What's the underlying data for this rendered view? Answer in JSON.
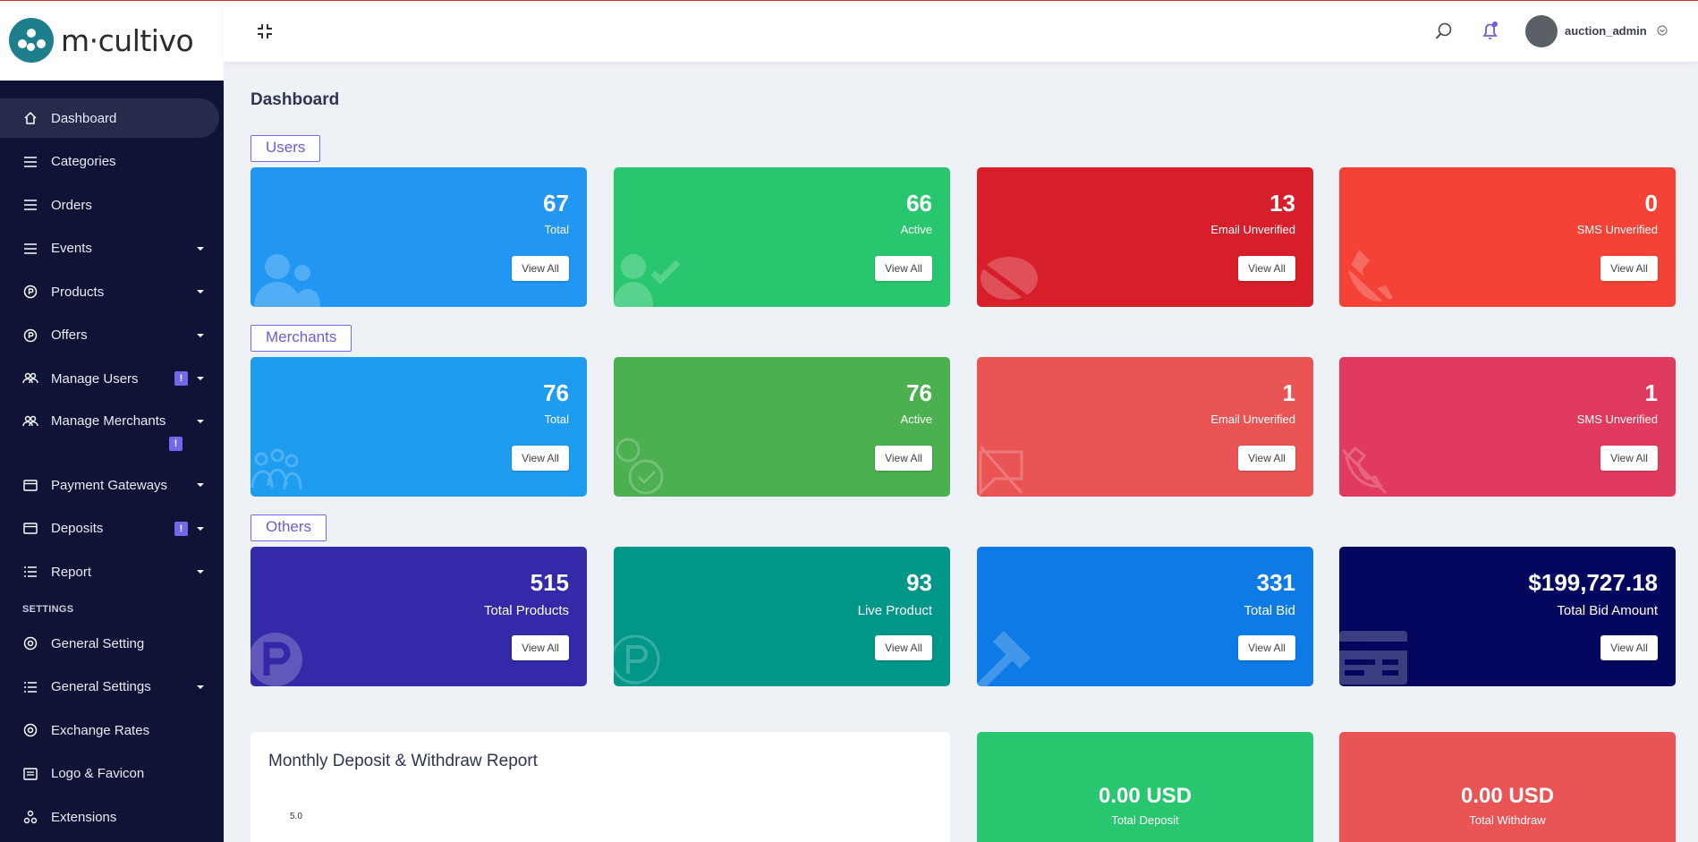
{
  "brand": {
    "name": "m·cultivo"
  },
  "header": {
    "username": "auction_admin"
  },
  "sidebar": {
    "items": [
      {
        "label": "Dashboard"
      },
      {
        "label": "Categories"
      },
      {
        "label": "Orders"
      },
      {
        "label": "Events"
      },
      {
        "label": "Products"
      },
      {
        "label": "Offers"
      },
      {
        "label": "Manage Users",
        "badge": "!"
      },
      {
        "label": "Manage Merchants",
        "badge": "!"
      },
      {
        "label": "Payment Gateways"
      },
      {
        "label": "Deposits",
        "badge": "!"
      },
      {
        "label": "Report"
      }
    ],
    "settings_heading": "SETTINGS",
    "settings_items": [
      {
        "label": "General Setting"
      },
      {
        "label": "General Settings"
      },
      {
        "label": "Exchange Rates"
      },
      {
        "label": "Logo & Favicon"
      },
      {
        "label": "Extensions"
      }
    ]
  },
  "page": {
    "title": "Dashboard"
  },
  "sections": {
    "users": {
      "label": "Users",
      "cards": [
        {
          "value": "67",
          "label": "Total",
          "button": "View All",
          "color": "#2196f3"
        },
        {
          "value": "66",
          "label": "Active",
          "button": "View All",
          "color": "#28c76f"
        },
        {
          "value": "13",
          "label": "Email Unverified",
          "button": "View All",
          "color": "#d71f2b"
        },
        {
          "value": "0",
          "label": "SMS Unverified",
          "button": "View All",
          "color": "#f44336"
        }
      ]
    },
    "merchants": {
      "label": "Merchants",
      "cards": [
        {
          "value": "76",
          "label": "Total",
          "button": "View All",
          "color": "#1e9cf0"
        },
        {
          "value": "76",
          "label": "Active",
          "button": "View All",
          "color": "#4caf50"
        },
        {
          "value": "1",
          "label": "Email Unverified",
          "button": "View All",
          "color": "#ea5455"
        },
        {
          "value": "1",
          "label": "SMS Unverified",
          "button": "View All",
          "color": "#e03b5f"
        }
      ]
    },
    "others": {
      "label": "Others",
      "cards": [
        {
          "value": "515",
          "label": "Total Products",
          "button": "View All",
          "color": "#3429a8"
        },
        {
          "value": "93",
          "label": "Live Product",
          "button": "View All",
          "color": "#009688"
        },
        {
          "value": "331",
          "label": "Total Bid",
          "button": "View All",
          "color": "#0e7ae6"
        },
        {
          "value": "$199,727.18",
          "label": "Total Bid Amount",
          "button": "View All",
          "color": "#05065e"
        }
      ]
    }
  },
  "report": {
    "title": "Monthly Deposit & Withdraw Report",
    "y_tick": "5.0"
  },
  "totals": {
    "deposit": {
      "amount": "0.00 USD",
      "label": "Total Deposit",
      "color": "#28c76f"
    },
    "withdraw": {
      "amount": "0.00 USD",
      "label": "Total Withdraw",
      "color": "#ea5455"
    }
  }
}
